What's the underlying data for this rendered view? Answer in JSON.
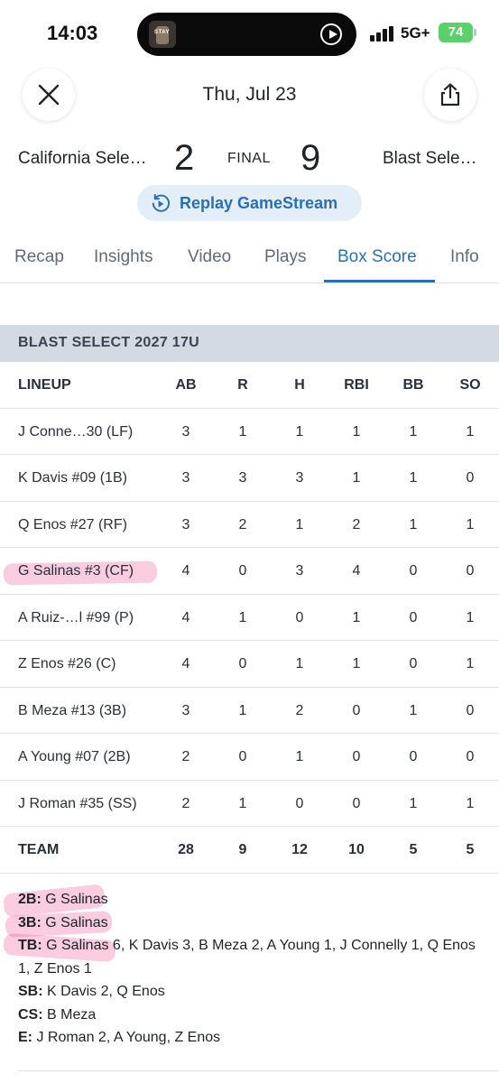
{
  "status_bar": {
    "time": "14:03",
    "island_art_text": "STAY",
    "network": "5G+",
    "battery": "74"
  },
  "header": {
    "date": "Thu, Jul 23",
    "close_icon": "close-icon",
    "share_icon": "share-icon"
  },
  "game": {
    "home_team": "California Sele…",
    "home_score": "2",
    "status": "FINAL",
    "away_score": "9",
    "away_team": "Blast Sele…"
  },
  "replay": {
    "label": "Replay GameStream",
    "icon": "replay-icon"
  },
  "tabs": [
    {
      "label": "Recap",
      "active": false
    },
    {
      "label": "Insights",
      "active": false
    },
    {
      "label": "Video",
      "active": false
    },
    {
      "label": "Plays",
      "active": false
    },
    {
      "label": "Box Score",
      "active": true
    },
    {
      "label": "Info",
      "active": false
    }
  ],
  "box_score": {
    "team_name": "BLAST SELECT 2027 17U",
    "columns": [
      "LINEUP",
      "AB",
      "R",
      "H",
      "RBI",
      "BB",
      "SO"
    ],
    "rows": [
      {
        "name": "J Conne…30 (LF)",
        "stats": [
          "3",
          "1",
          "1",
          "1",
          "1",
          "1"
        ]
      },
      {
        "name": "K Davis #09 (1B)",
        "stats": [
          "3",
          "3",
          "3",
          "1",
          "1",
          "0"
        ]
      },
      {
        "name": "Q Enos #27 (RF)",
        "stats": [
          "3",
          "2",
          "1",
          "2",
          "1",
          "1"
        ]
      },
      {
        "name": "G Salinas #3 (CF)",
        "stats": [
          "4",
          "0",
          "3",
          "4",
          "0",
          "0"
        ]
      },
      {
        "name": "A Ruiz-…l #99 (P)",
        "stats": [
          "4",
          "1",
          "0",
          "1",
          "0",
          "1"
        ]
      },
      {
        "name": "Z Enos #26 (C)",
        "stats": [
          "4",
          "0",
          "1",
          "1",
          "0",
          "1"
        ]
      },
      {
        "name": "B Meza #13 (3B)",
        "stats": [
          "3",
          "1",
          "2",
          "0",
          "1",
          "0"
        ]
      },
      {
        "name": "A Young #07 (2B)",
        "stats": [
          "2",
          "0",
          "1",
          "0",
          "0",
          "0"
        ]
      },
      {
        "name": "J Roman #35 (SS)",
        "stats": [
          "2",
          "1",
          "0",
          "0",
          "1",
          "1"
        ]
      }
    ],
    "team_totals": {
      "name": "TEAM",
      "stats": [
        "28",
        "9",
        "12",
        "10",
        "5",
        "5"
      ]
    }
  },
  "notes": [
    {
      "label": "2B:",
      "text": " G Salinas"
    },
    {
      "label": "3B:",
      "text": " G Salinas"
    },
    {
      "label": "TB:",
      "text": " G Salinas 6, K Davis 3, B Meza 2, A Young 1, J Connelly 1, Q Enos 1, Z Enos 1"
    },
    {
      "label": "SB:",
      "text": " K Davis 2, Q Enos"
    },
    {
      "label": "CS:",
      "text": " B Meza"
    },
    {
      "label": "E:",
      "text": " J Roman 2, A Young, Z Enos"
    }
  ],
  "colors": {
    "accent": "#2b6fad",
    "section_bg": "#d3dae2",
    "highlight": "#ec5fa0",
    "battery": "#5bd06b"
  }
}
